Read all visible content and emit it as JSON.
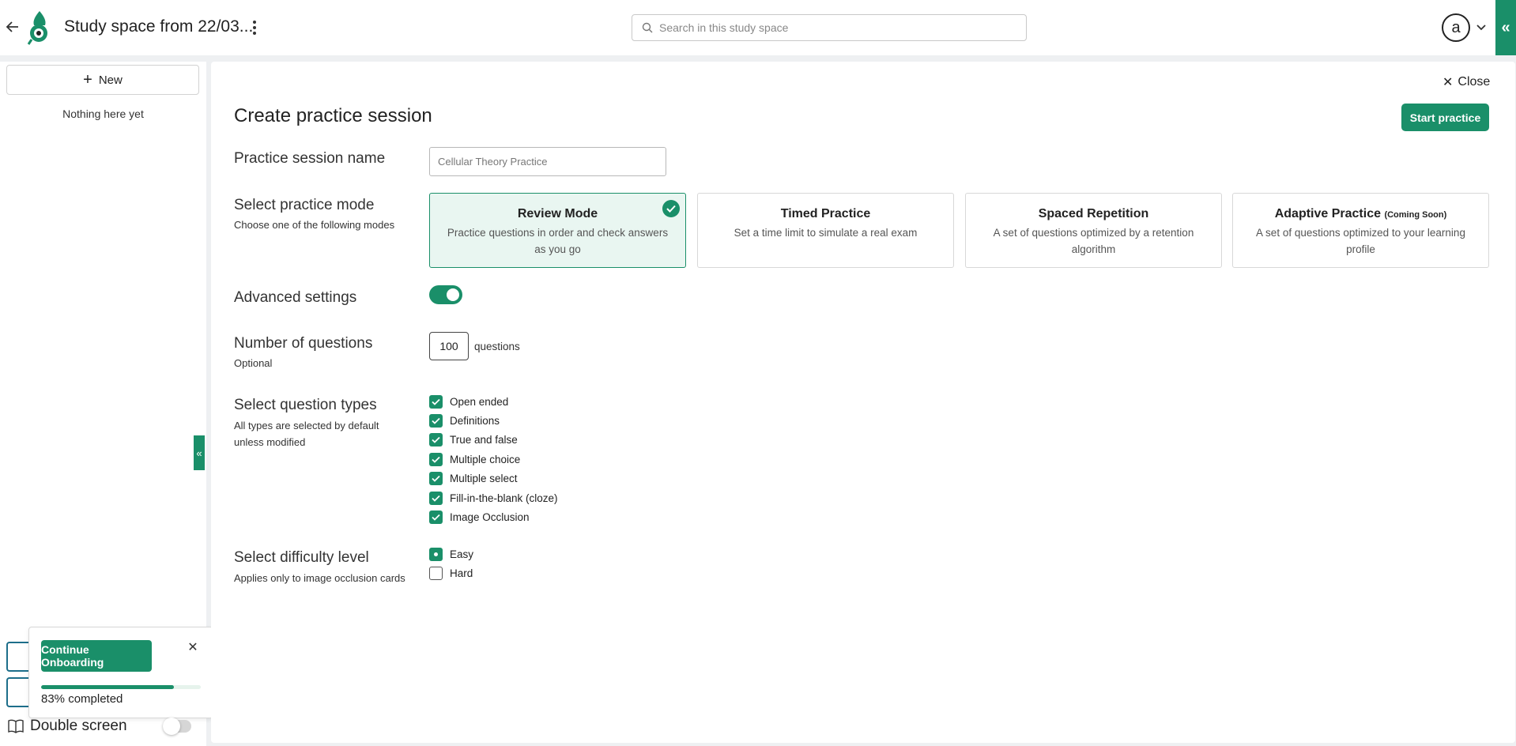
{
  "header": {
    "title": "Study space from 22/03...",
    "search_placeholder": "Search in this study space",
    "avatar_letter": "a",
    "right_tab_glyph": "«"
  },
  "sidebar": {
    "new_label": "New",
    "empty_text": "Nothing here yet",
    "collapse_glyph": "«",
    "onboarding": {
      "button_label": "Continue Onboarding",
      "progress_percent": 83,
      "progress_text": "83% completed"
    },
    "double_screen_label": "Double screen",
    "double_screen_enabled": false
  },
  "main": {
    "close_label": "Close",
    "heading": "Create practice session",
    "start_label": "Start practice",
    "session_name": {
      "label": "Practice session name",
      "value": "Cellular Theory Practice"
    },
    "mode": {
      "label": "Select practice mode",
      "sublabel": "Choose one of the following modes",
      "options": [
        {
          "title": "Review Mode",
          "tag": "",
          "desc": "Practice questions in order and check answers as you go",
          "selected": true
        },
        {
          "title": "Timed Practice",
          "tag": "",
          "desc": "Set a time limit to simulate a real exam",
          "selected": false
        },
        {
          "title": "Spaced Repetition",
          "tag": "",
          "desc": "A set of questions optimized by a retention algorithm",
          "selected": false
        },
        {
          "title": "Adaptive Practice",
          "tag": "(Coming Soon)",
          "desc": "A set of questions optimized to your learning profile",
          "selected": false
        }
      ]
    },
    "advanced": {
      "label": "Advanced settings",
      "enabled": true
    },
    "num_questions": {
      "label": "Number of questions",
      "sublabel": "Optional",
      "value": "100",
      "unit": "questions"
    },
    "question_types": {
      "label": "Select question types",
      "sublabel_1": "All types are selected by default",
      "sublabel_2": "unless modified",
      "items": [
        {
          "label": "Open ended",
          "checked": true
        },
        {
          "label": "Definitions",
          "checked": true
        },
        {
          "label": "True and false",
          "checked": true
        },
        {
          "label": "Multiple choice",
          "checked": true
        },
        {
          "label": "Multiple select",
          "checked": true
        },
        {
          "label": "Fill-in-the-blank (cloze)",
          "checked": true
        },
        {
          "label": "Image Occlusion",
          "checked": true
        }
      ]
    },
    "difficulty": {
      "label": "Select difficulty level",
      "sublabel": "Applies only to image occlusion cards",
      "items": [
        {
          "label": "Easy",
          "selected": true
        },
        {
          "label": "Hard",
          "selected": false
        }
      ]
    }
  },
  "colors": {
    "accent": "#1a8f69",
    "selected_card_bg": "#e9f6f1",
    "ghost_button_border": "#1d6e8a"
  }
}
